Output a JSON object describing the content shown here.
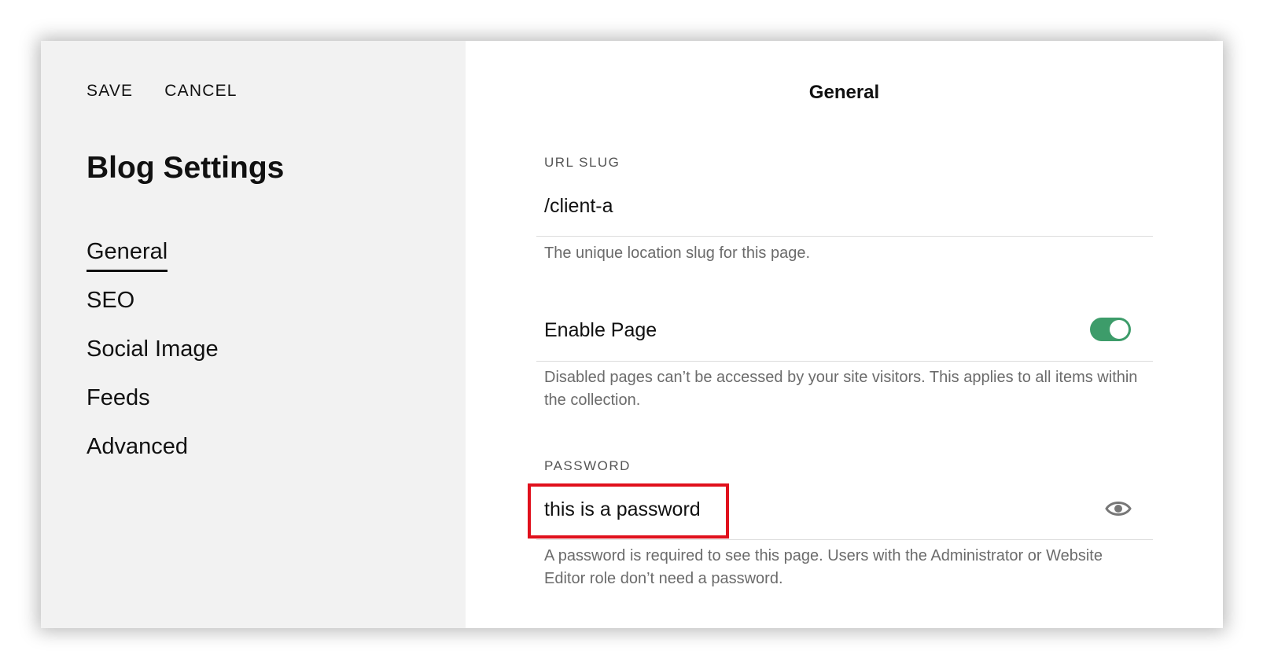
{
  "sidebar": {
    "actions": {
      "save": "SAVE",
      "cancel": "CANCEL"
    },
    "title": "Blog Settings",
    "nav": [
      {
        "label": "General",
        "active": true
      },
      {
        "label": "SEO"
      },
      {
        "label": "Social Image"
      },
      {
        "label": "Feeds"
      },
      {
        "label": "Advanced"
      }
    ]
  },
  "main": {
    "title": "General",
    "url_slug": {
      "label": "URL SLUG",
      "value": "/client-a",
      "help": "The unique location slug for this page."
    },
    "enable_page": {
      "label": "Enable Page",
      "enabled": true,
      "help": "Disabled pages can’t be accessed by your site visitors. This applies to all items within the collection."
    },
    "password": {
      "label": "PASSWORD",
      "value": "this is a password",
      "help": "A password is required to see this page. Users with the Administrator or Website Editor role don’t need a password."
    }
  },
  "colors": {
    "sidebar_bg": "#f2f2f2",
    "toggle_on": "#3d9c6a",
    "highlight": "#e0101c"
  },
  "icons": {
    "password_visibility": "eye-icon"
  }
}
